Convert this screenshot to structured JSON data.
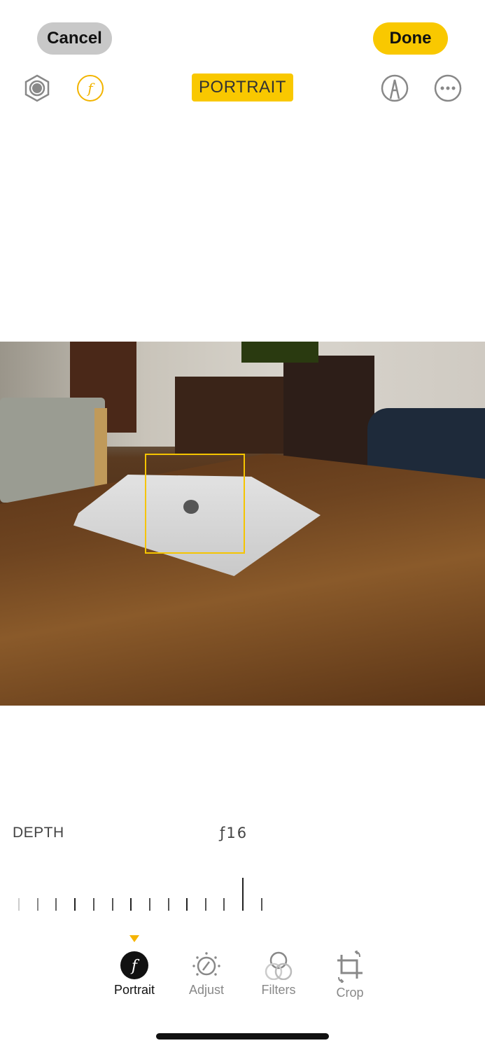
{
  "header": {
    "cancel_label": "Cancel",
    "done_label": "Done",
    "mode_badge": "PORTRAIT"
  },
  "toolbar_icons": [
    "live-photo-icon",
    "aperture-f-icon",
    "markup-pen-icon",
    "more-icon"
  ],
  "depth": {
    "label": "DEPTH",
    "value": "ƒ16",
    "slider_value": 16
  },
  "tabs": [
    {
      "label": "Portrait",
      "icon": "aperture-f-icon",
      "active": true
    },
    {
      "label": "Adjust",
      "icon": "adjust-dial-icon"
    },
    {
      "label": "Filters",
      "icon": "filters-icon"
    },
    {
      "label": "Crop",
      "icon": "crop-rotate-icon"
    }
  ],
  "colors": {
    "accent": "#f9c800",
    "cancel_bg": "#c8c8c8"
  }
}
